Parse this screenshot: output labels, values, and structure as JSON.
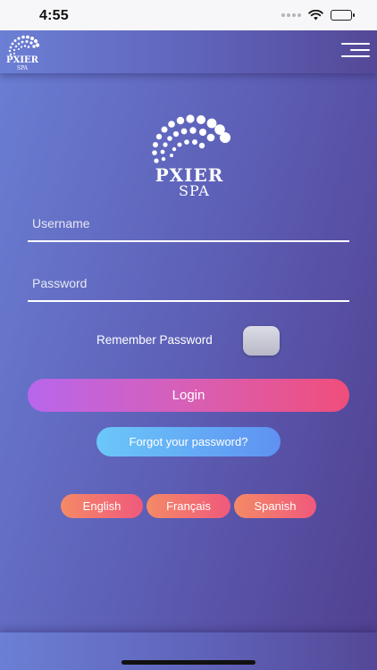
{
  "status_bar": {
    "time": "4:55",
    "icons": [
      "signal-dots-icon",
      "wifi-icon",
      "battery-icon"
    ]
  },
  "header": {
    "logo_title": "PXIER",
    "logo_subtitle": "SPA",
    "menu_icon": "hamburger-menu-icon"
  },
  "brand": {
    "title": "PXIER",
    "subtitle": "SPA"
  },
  "form": {
    "username_placeholder": "Username",
    "username_value": "",
    "password_placeholder": "Password",
    "password_value": "",
    "remember_label": "Remember Password",
    "remember_checked": false,
    "login_label": "Login",
    "forgot_label": "Forgot your password?"
  },
  "languages": [
    {
      "label": "English"
    },
    {
      "label": "Français"
    },
    {
      "label": "Spanish"
    }
  ],
  "colors": {
    "background_start": "#6a7ed3",
    "background_end": "#503f8f",
    "login_start": "#b866ec",
    "login_end": "#f04e7b",
    "forgot_start": "#6bc8f9",
    "forgot_end": "#5f91f2",
    "lang_start": "#f48a66",
    "lang_end": "#f0597c"
  }
}
